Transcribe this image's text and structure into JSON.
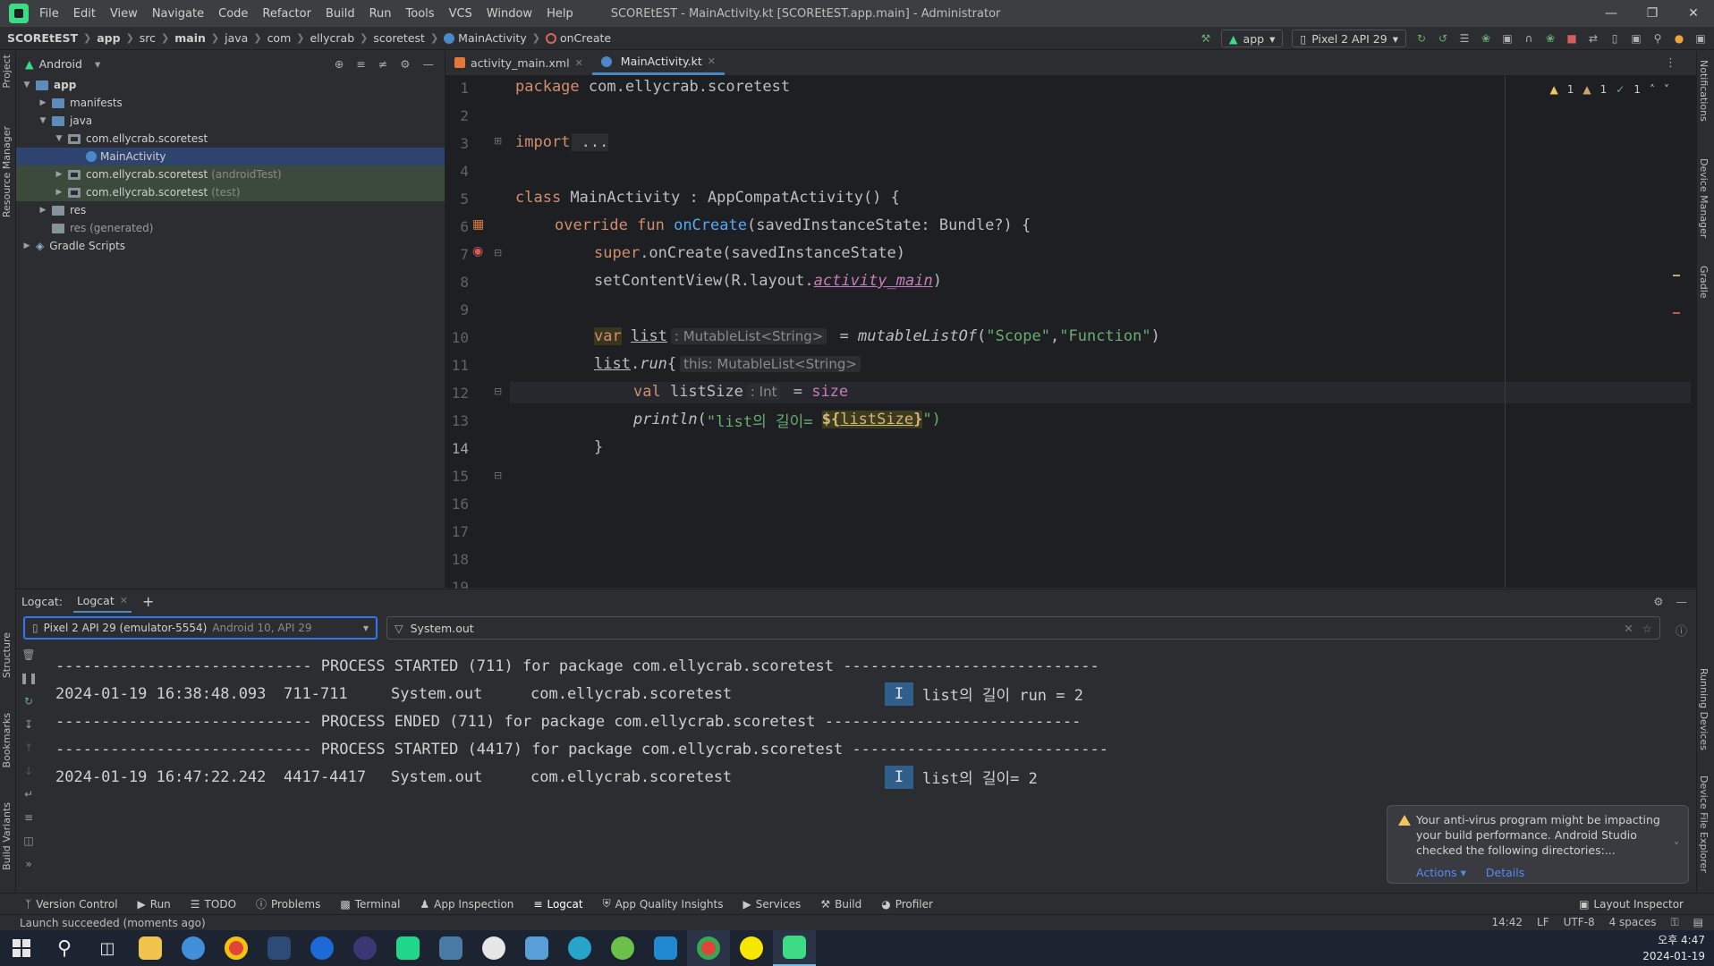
{
  "titlebar": {
    "menu": [
      "File",
      "Edit",
      "View",
      "Navigate",
      "Code",
      "Refactor",
      "Build",
      "Run",
      "Tools",
      "VCS",
      "Window",
      "Help"
    ],
    "window_title": "SCOREtEST - MainActivity.kt [SCOREtEST.app.main] - Administrator"
  },
  "breadcrumb": {
    "project": "SCOREtEST",
    "items": [
      "app",
      "src",
      "main",
      "java",
      "com",
      "ellycrab",
      "scoretest",
      "MainActivity",
      "onCreate"
    ]
  },
  "run_tools": {
    "config": "app",
    "device": "Pixel 2 API 29"
  },
  "left_strip": {
    "top": [
      "Project",
      "Resource Manager"
    ],
    "bottom": [
      "Structure",
      "Bookmarks",
      "Build Variants"
    ]
  },
  "right_strip": [
    "Notifications",
    "Device Manager",
    "Gradle",
    "Running Devices",
    "Device File Explorer"
  ],
  "project_panel": {
    "view": "Android",
    "tree": [
      {
        "label": "app",
        "muted": ""
      },
      {
        "label": "manifests",
        "muted": ""
      },
      {
        "label": "java",
        "muted": ""
      },
      {
        "label": "com.ellycrab.scoretest",
        "muted": ""
      },
      {
        "label": "MainActivity",
        "muted": ""
      },
      {
        "label": "com.ellycrab.scoretest",
        "muted": "(androidTest)"
      },
      {
        "label": "com.ellycrab.scoretest",
        "muted": "(test)"
      },
      {
        "label": "res",
        "muted": ""
      },
      {
        "label": "res (generated)",
        "muted": ""
      },
      {
        "label": "Gradle Scripts",
        "muted": ""
      }
    ]
  },
  "editor": {
    "tabs": [
      {
        "label": "activity_main.xml"
      },
      {
        "label": "MainActivity.kt"
      }
    ],
    "inspections": {
      "warnings": "1",
      "weak": "1",
      "ok": "1"
    },
    "line_numbers": [
      "1",
      "2",
      "3",
      "4",
      "5",
      "6",
      "7",
      "8",
      "9",
      "10",
      "11",
      "12",
      "13",
      "14",
      "15",
      "16",
      "17",
      "18",
      "19"
    ],
    "code": {
      "l1_kw": "package",
      "l1_rest": " com.ellycrab.scoretest",
      "l3_kw": "import",
      "l3_rest": " ...",
      "l6_kw": "class",
      "l6_rest": " MainActivity : AppCompatActivity() {",
      "l7_kw": "override fun",
      "l7_fn": "onCreate",
      "l7_rest": "(savedInstanceState: Bundle?) {",
      "l8_kw": "super",
      "l8_rest": ".onCreate(savedInstanceState)",
      "l9_a": "setContentView(R.layout.",
      "l9_b": "activity_main",
      "l9_c": ")",
      "l11_kw": "var",
      "l11_var": "list",
      "l11_hint": ": MutableList<String>",
      "l11_eq": " = ",
      "l11_fn": "mutableListOf",
      "l11_open": "(",
      "l11_s1": "\"Scope\"",
      "l11_comma": ",",
      "l11_s2": "\"Function\"",
      "l11_close": ")",
      "l12_var": "list",
      "l12_dot": ".",
      "l12_fn": "run",
      "l12_brace": "{",
      "l12_hint": "this: MutableList<String>",
      "l13_kw": "val",
      "l13_var": " listSize",
      "l13_hint": ": Int",
      "l13_eq": " = ",
      "l13_size": "size",
      "l14_fn": "println",
      "l14_open": "(",
      "l14_str": "\"list의 길이= ",
      "l14_tmpl_open": "${",
      "l14_tmpl_var": "listSize",
      "l14_tmpl_close": "}",
      "l14_end": "\")",
      "l15": "}"
    }
  },
  "logcat": {
    "label": "Logcat:",
    "tab": "Logcat",
    "device": "Pixel 2 API 29 (emulator-5554)",
    "device_sub": "Android 10, API 29",
    "filter": "System.out",
    "lines": [
      {
        "type": "sep",
        "text": "---------------------------- PROCESS STARTED (711) for package com.ellycrab.scoretest ----------------------------"
      },
      {
        "type": "log",
        "time": "2024-01-19 16:38:48.093",
        "pid": "711-711",
        "tag": "System.out",
        "pkg": "com.ellycrab.scoretest",
        "level": "I",
        "msg": "list의 길이 run = 2"
      },
      {
        "type": "sep",
        "text": "---------------------------- PROCESS ENDED (711) for package com.ellycrab.scoretest ----------------------------"
      },
      {
        "type": "sep",
        "text": "---------------------------- PROCESS STARTED (4417) for package com.ellycrab.scoretest ----------------------------"
      },
      {
        "type": "log",
        "time": "2024-01-19 16:47:22.242",
        "pid": "4417-4417",
        "tag": "System.out",
        "pkg": "com.ellycrab.scoretest",
        "level": "I",
        "msg": "list의 길이= 2"
      }
    ]
  },
  "notification": {
    "lines": [
      "Your anti-virus program might be impacting",
      "your build performance. Android Studio",
      "checked the following directories:..."
    ],
    "action1": "Actions",
    "action2": "Details"
  },
  "toolwindows": [
    "Version Control",
    "Run",
    "TODO",
    "Problems",
    "Terminal",
    "App Inspection",
    "Logcat",
    "App Quality Insights",
    "Services",
    "Build",
    "Profiler"
  ],
  "layout_inspector": "Layout Inspector",
  "status": {
    "message": "Launch succeeded (moments ago)",
    "pos": "14:42",
    "eol": "LF",
    "enc": "UTF-8",
    "indent": "4 spaces"
  },
  "clock": {
    "ampm_time": "오후 4:47",
    "date": "2024-01-19"
  },
  "colors": {
    "accent": "#3574f0",
    "keyword": "#cf8e6d",
    "string": "#6aab73",
    "function": "#56a8f5"
  }
}
